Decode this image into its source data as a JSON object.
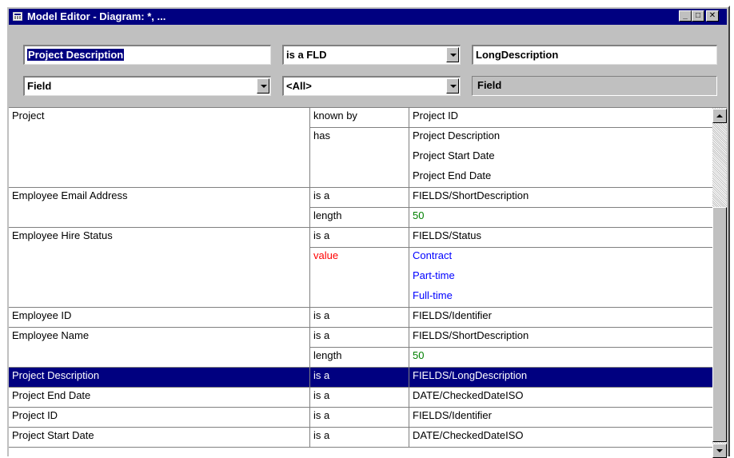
{
  "window": {
    "title": "Model Editor - Diagram: *, ...",
    "min_glyph": "_",
    "max_glyph": "□",
    "close_glyph": "✕"
  },
  "toolbar": {
    "name_value": "Project Description",
    "relation_value": "is a FLD",
    "target_value": "LongDescription",
    "type_value": "Field",
    "filter_value": "<All>",
    "target_type": "Field"
  },
  "grid": {
    "rows": [
      {
        "c1": "Project",
        "c2": "known by",
        "c3": "Project ID"
      },
      {
        "c1": "",
        "c2": "has",
        "c3": "Project Description"
      },
      {
        "c1": "",
        "c2": "",
        "c3": "Project Start Date"
      },
      {
        "c1": "",
        "c2": "",
        "c3": "Project End Date"
      },
      {
        "c1": "Employee Email Address",
        "c2": "is a",
        "c3": "FIELDS/ShortDescription"
      },
      {
        "c1": "",
        "c2": "length",
        "c3": "50"
      },
      {
        "c1": "Employee Hire Status",
        "c2": "is a",
        "c3": "FIELDS/Status"
      },
      {
        "c1": "",
        "c2": "value",
        "c3": "Contract"
      },
      {
        "c1": "",
        "c2": "",
        "c3": "Part-time"
      },
      {
        "c1": "",
        "c2": "",
        "c3": "Full-time"
      },
      {
        "c1": "Employee ID",
        "c2": "is a",
        "c3": "FIELDS/Identifier"
      },
      {
        "c1": "Employee Name",
        "c2": "is a",
        "c3": "FIELDS/ShortDescription"
      },
      {
        "c1": "",
        "c2": "length",
        "c3": "50"
      },
      {
        "c1": "Project Description",
        "c2": "is a",
        "c3": "FIELDS/LongDescription"
      },
      {
        "c1": "Project End Date",
        "c2": "is a",
        "c3": "DATE/CheckedDateISO"
      },
      {
        "c1": "Project ID",
        "c2": "is a",
        "c3": "FIELDS/Identifier"
      },
      {
        "c1": "Project Start Date",
        "c2": "is a",
        "c3": "DATE/CheckedDateISO"
      }
    ]
  },
  "colors": {
    "selection": "#000080",
    "numeric_value": "#008000",
    "value_keyword": "#ff0000",
    "enum_value": "#0000ff"
  },
  "icons": {
    "window": "table-icon",
    "dropdown": "chevron-down-icon",
    "scroll_up": "arrow-up-icon",
    "scroll_down": "arrow-down-icon"
  }
}
